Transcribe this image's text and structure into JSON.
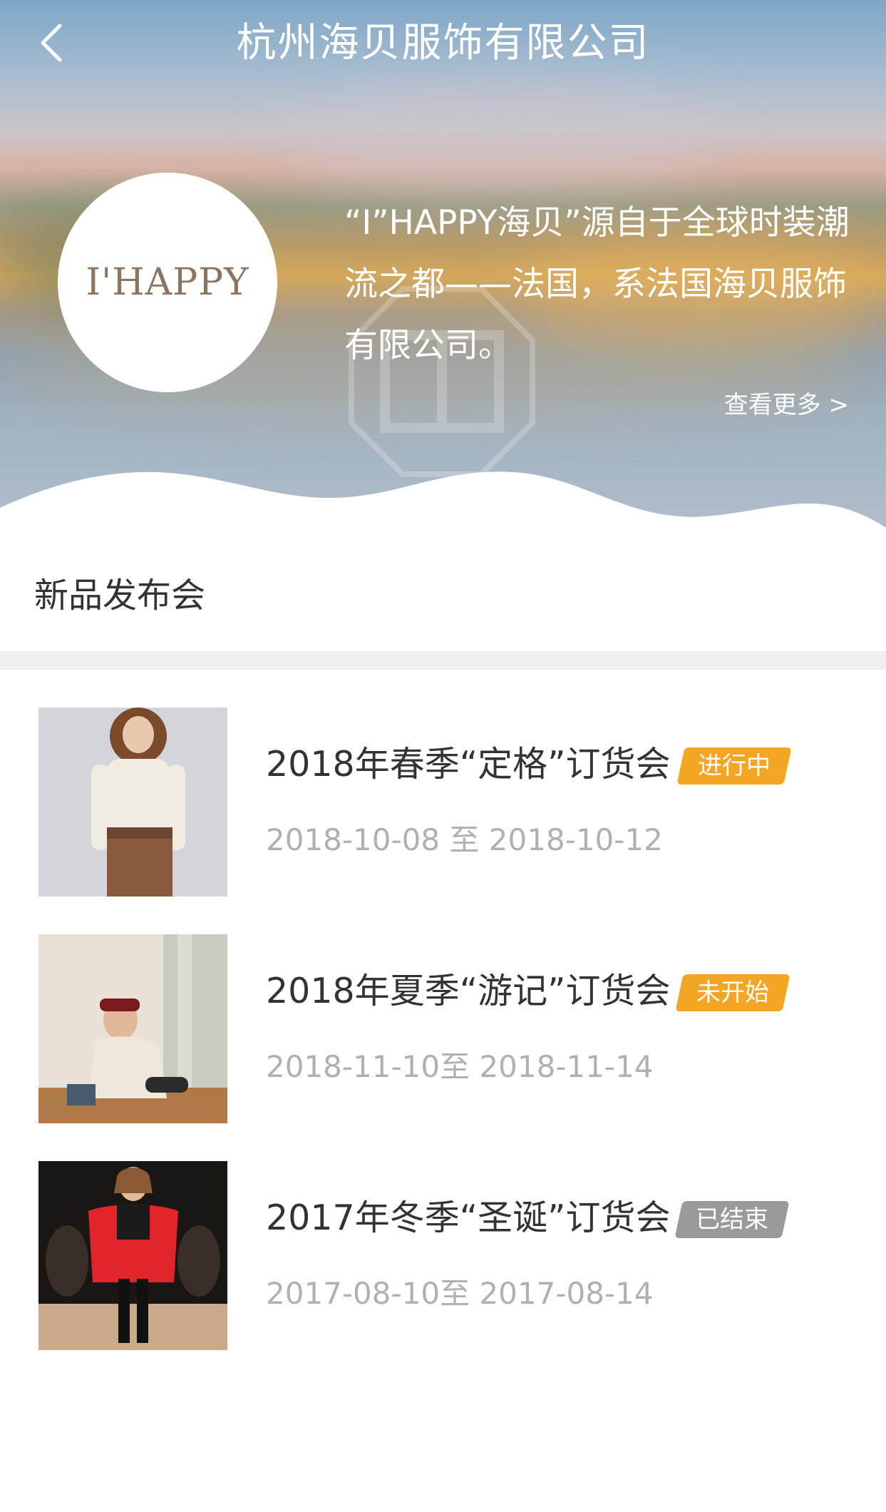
{
  "nav": {
    "title": "杭州海贝服饰有限公司"
  },
  "brand": {
    "logo_text": "I'HAPPY",
    "intro": "“I”HAPPY海贝”源自于全球时装潮流之都——法国，系法国海贝服饰有限公司。",
    "more_label": "查看更多 >"
  },
  "section": {
    "title": "新品发布会"
  },
  "events": [
    {
      "title": "2018年春季“定格”订货会",
      "status": "进行中",
      "status_color": "#f2a623",
      "date": "2018-10-08 至 2018-10-12"
    },
    {
      "title": "2018年夏季“游记”订货会",
      "status": "未开始",
      "status_color": "#f2a623",
      "date": "2018-11-10至 2018-11-14"
    },
    {
      "title": "2017年冬季“圣诞”订货会",
      "status": "已结束",
      "status_color": "#9a9a9a",
      "date": "2017-08-10至 2017-08-14"
    }
  ],
  "colors": {
    "accent": "#f2a623",
    "ended": "#9a9a9a",
    "title_text": "#333333",
    "date_text": "#b0b0b0",
    "divider": "#efeff1"
  }
}
